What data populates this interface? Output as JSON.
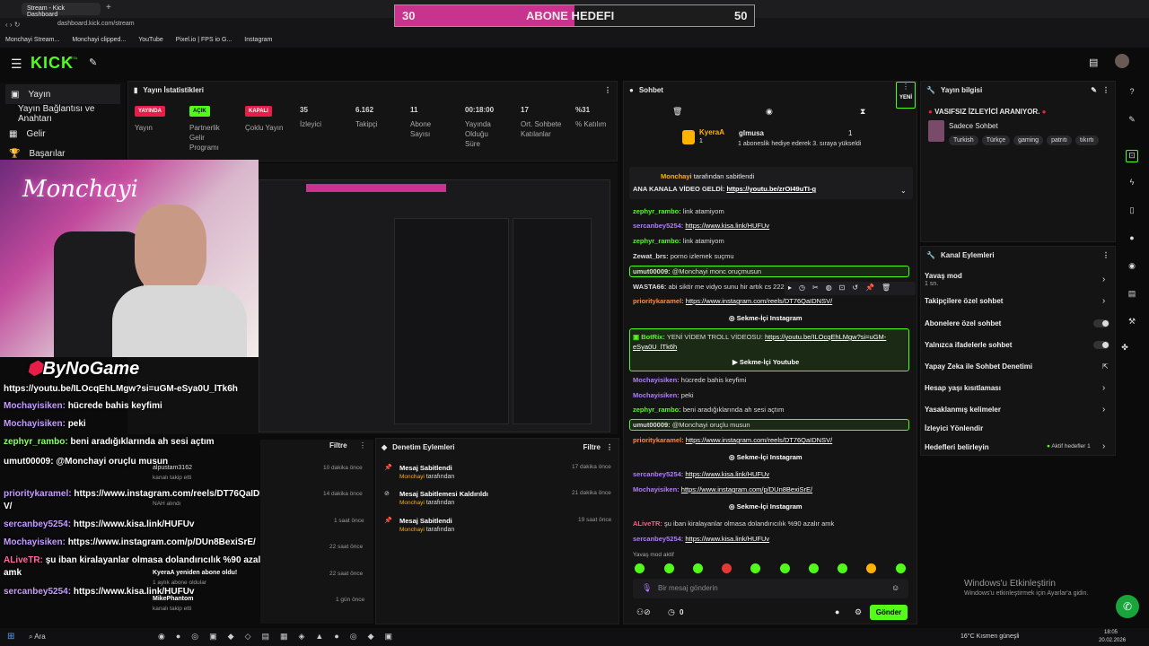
{
  "browser": {
    "tab_title": "Stream - Kick Dashboard",
    "url": "dashboard.kick.com/stream",
    "bookmarks": [
      "Monchayi Stream...",
      "Monchayi clipped...",
      "YouTube",
      "Pixel.io | FPS io G...",
      "Instagram"
    ]
  },
  "goal_overlay": {
    "start": "30",
    "title": "ABONE HEDEFI",
    "end": "50",
    "progress": 0.5
  },
  "header": {
    "logo": "KICK",
    "logo_sup": "BETA"
  },
  "left_nav": {
    "items": [
      "Yayın",
      "Yayın Bağlantısı ve Anahtarı",
      "Gelir",
      "Başarılar"
    ]
  },
  "stats_panel": {
    "title": "Yayın İstatistikleri",
    "stats": [
      {
        "value": "YAYINDA",
        "label": "Yayın"
      },
      {
        "value": "AÇIK",
        "label": "Partnerlik Gelir Programı"
      },
      {
        "value": "KAPALI",
        "label": "Çoklu Yayın"
      },
      {
        "value": "35",
        "label": "İzleyici"
      },
      {
        "value": "6.162",
        "label": "Takipçi"
      },
      {
        "value": "11",
        "label": "Abone Sayısı"
      },
      {
        "value": "00:18:00",
        "label": "Yayında Olduğu Süre"
      },
      {
        "value": "17",
        "label": "Ort. Sohbete Katılanlar"
      },
      {
        "value": "%31",
        "label": "% Katılım"
      }
    ]
  },
  "stream_overlay": {
    "brand": "Monchayi",
    "sponsor": "ByNoGame",
    "chat": [
      {
        "user": "",
        "text": "https://youtu.be/ILOcqEhLMgw?si=uGM-eSya0U_lTk6h"
      },
      {
        "user": "Mochayisiken:",
        "text": "hücrede bahis keyfimi"
      },
      {
        "user": "Mochayisiken:",
        "text": "peki"
      },
      {
        "user": "zephyr_rambo:",
        "text": "beni aradığıklarında ah sesi açtım"
      },
      {
        "user": "umut00009:",
        "text": "@Monchayi oruçlu musun"
      },
      {
        "user": "prioritykaramel:",
        "text": "https://www.instagram.com/reels/DT76QaIDNS"
      },
      {
        "user": "",
        "text": "V/"
      },
      {
        "user": "sercanbey5254:",
        "text": "https://www.kisa.link/HUFUv"
      },
      {
        "user": "Mochayisiken:",
        "text": "https://www.instagram.com/p/DUn8BexiSrE/"
      },
      {
        "user": "ALiveTR:",
        "text": "şu iban kiralayanlar olmasa dolandırıcılık %90 azalır"
      },
      {
        "user": "",
        "text": "amk"
      },
      {
        "user": "sercanbey5254:",
        "text": "https://www.kisa.link/HUFUv"
      }
    ]
  },
  "events_panel": {
    "filter": "Filtre",
    "items": [
      {
        "name": "alpustam3162",
        "desc": "kanalı takip etti",
        "time": "10 dakika önce"
      },
      {
        "name": "",
        "desc": "NAH alındı",
        "time": "14 dakika önce"
      },
      {
        "name": "",
        "desc": "",
        "time": "1 saat önce"
      },
      {
        "name": "",
        "desc": "",
        "time": "22 saat önce"
      },
      {
        "name": "KyeraA yeniden abone oldu!",
        "desc": "1 aylık abone oldular",
        "time": "22 saat önce"
      },
      {
        "name": "MikePhantom",
        "desc": "kanalı takip etti",
        "time": "1 gün önce"
      }
    ]
  },
  "moderation_panel": {
    "title": "Denetim Eylemleri",
    "filter": "Filtre",
    "items": [
      {
        "title": "Mesaj Sabitlendi",
        "by": "Monchayi",
        "suffix": "tarafından",
        "time": "17 dakika önce"
      },
      {
        "title": "Mesaj Sabitlemesi Kaldırıldı",
        "by": "Monchayi",
        "suffix": "tarafından",
        "time": "21 dakika önce"
      },
      {
        "title": "Mesaj Sabitlendi",
        "by": "Monchayi",
        "suffix": "tarafından",
        "time": "19 saat önce"
      }
    ]
  },
  "chat_panel": {
    "title": "Sohbet",
    "new_label": "YENİ",
    "top_users": [
      {
        "name": "KyeraA",
        "count": "1"
      },
      {
        "name": "glmusa",
        "count": "1"
      }
    ],
    "gift_text": "1 aboneslik hediye ederek 3. sıraya yükseldi",
    "pinned": {
      "by": "Monchayi",
      "suffix": "tarafından sabitlendi",
      "text": "ANA KANALA VİDEO GELDİ:",
      "link": "https://youtu.be/zrOI49uTI-g"
    },
    "messages": [
      {
        "user": "zephyr_rambo:",
        "text": "link atamiyom"
      },
      {
        "user": "sercanbey5254:",
        "text": "https://www.kisa.link/HUFUv"
      },
      {
        "user": "zephyr_rambo:",
        "text": "link atamiyom"
      },
      {
        "user": "Zewat_brs:",
        "text": "porno izlemek suçmu"
      },
      {
        "user": "umut00009:",
        "text": "@Monchayi monc oruçmusun"
      },
      {
        "user": "WASTA66:",
        "text": "abi siktir me vidyo sunu hir artık cs 222"
      },
      {
        "user": "prioritykaramel:",
        "text": "https://www.instagram.com/reels/DT76QaIDNSV/"
      },
      {
        "user": "Sekme-İçi Instagram",
        "text": ""
      },
      {
        "user": "BotRix:",
        "text": "YENİ VİDEM TROLL VİDEOSU:",
        "link": "https://youtu.be/ILOcqEhLMgw?si=uGM-eSya0U_lTk6h"
      },
      {
        "user": "Sekme-İçi Youtube",
        "text": ""
      },
      {
        "user": "Mochayisiken:",
        "text": "hücrede bahis keyfimi"
      },
      {
        "user": "Mochayisiken:",
        "text": "peki"
      },
      {
        "user": "zephyr_rambo:",
        "text": "beni aradığıklarında ah sesi açtım"
      },
      {
        "user": "umut00009:",
        "text": "@Monchayi oruçlu musun"
      },
      {
        "user": "prioritykaramel:",
        "text": "https://www.instagram.com/reels/DT76QaIDNSV/"
      },
      {
        "user": "Sekme-İçi Instagram",
        "text": ""
      },
      {
        "user": "sercanbey5254:",
        "text": "https://www.kisa.link/HUFUv"
      },
      {
        "user": "Mochayisiken:",
        "text": "https://www.instagram.com/p/DUn8BexiSrE/"
      },
      {
        "user": "Sekme-İçi Instagram",
        "text": ""
      },
      {
        "user": "ALiveTR:",
        "text": "şu iban kiralayanlar olmasa dolandırıcılık %90 azalır amk"
      },
      {
        "user": "sercanbey5254:",
        "text": "https://www.kisa.link/HUFUv"
      }
    ],
    "slow_mode": "Yavaş mod aktif",
    "input_placeholder": "Bir mesaj gönderin",
    "count": "0",
    "send_label": "Gönder"
  },
  "stream_info": {
    "title": "Yayın bilgisi",
    "stream_title": "VASIFSIZ İZLEYİCİ ARANIYOR.",
    "category": "Sadece Sohbet",
    "tags": [
      "Turkish",
      "Türkçe",
      "gaming",
      "patrıtı",
      "tıkırtı"
    ]
  },
  "channel_actions": {
    "title": "Kanal Eylemleri",
    "slow_mode": "Yavaş mod",
    "slow_mode_value": "1 sn.",
    "items": [
      "Takipçilere özel sohbet",
      "Abonelere özel sohbet",
      "Yalnızca ifadelerle sohbet",
      "Yapay Zeka ile Sohbet Denetimi",
      "Hesap yaşı kısıtlaması",
      "Yasaklanmış kelimeler",
      "İzleyici Yönlendir",
      "Hedefleri belirleyin"
    ],
    "goal_status": "Aktif hedefler",
    "goal_count": "1"
  },
  "windows_watermark": {
    "line1": "Windows'u Etkinleştirin",
    "line2": "Windows'u etkinleştirmek için Ayarlar'a gidin."
  },
  "taskbar": {
    "search": "Ara",
    "weather": "16°C  Kısmen güneşli",
    "time": "18:05",
    "date": "20.02.2026"
  },
  "colors": {
    "accent": "#53fc18",
    "live": "#e91e48",
    "goal_bar": "#c8348d"
  }
}
